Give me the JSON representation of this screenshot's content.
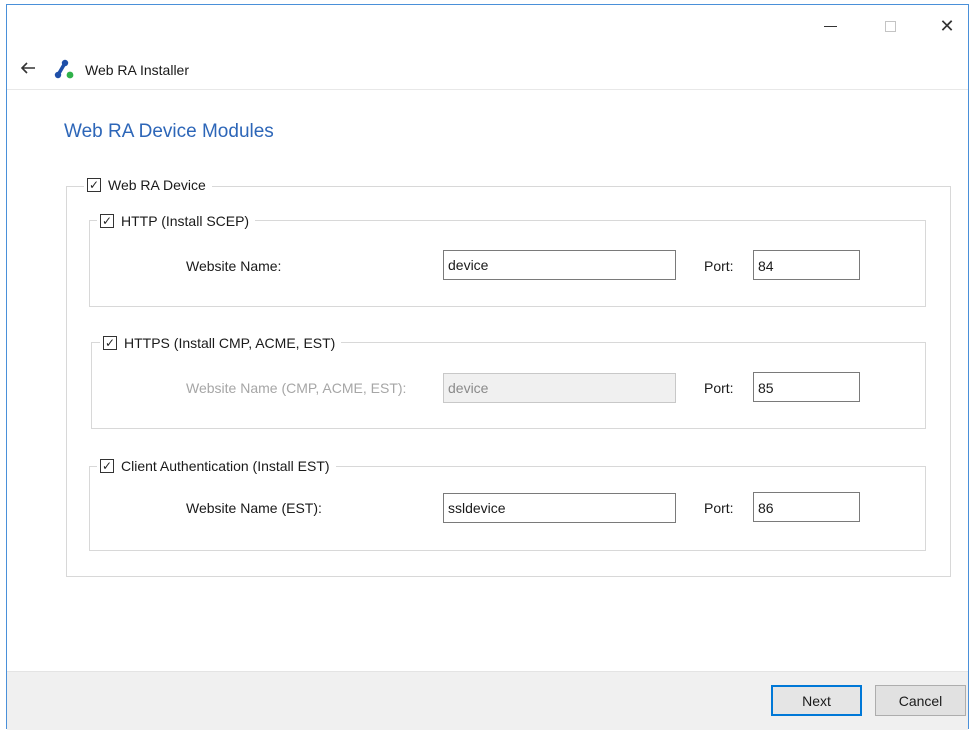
{
  "window": {
    "app_title": "Web RA Installer",
    "caption": {
      "minimize": "—",
      "maximize": "☐",
      "close": "✕"
    },
    "back_icon": "back-arrow-icon",
    "logo_icon": "app-logo-icon"
  },
  "page": {
    "title": "Web RA Device Modules"
  },
  "device_group": {
    "label": "Web RA Device",
    "checked": true
  },
  "http": {
    "label": "HTTP (Install SCEP)",
    "checked": true,
    "website_label": "Website Name:",
    "website_value": "device",
    "port_label": "Port:",
    "port_value": "84"
  },
  "https": {
    "label": "HTTPS (Install CMP, ACME, EST)",
    "checked": true,
    "website_label": "Website Name (CMP, ACME, EST):",
    "website_value": "device",
    "website_disabled": true,
    "port_label": "Port:",
    "port_value": "85"
  },
  "client_auth": {
    "label": "Client Authentication (Install EST)",
    "checked": true,
    "website_label": "Website Name (EST):",
    "website_value": "ssldevice",
    "port_label": "Port:",
    "port_value": "86"
  },
  "footer": {
    "next_label": "Next",
    "cancel_label": "Cancel"
  },
  "colors": {
    "accent": "#0078d7",
    "title_blue": "#2d66b8",
    "window_border": "#4a90d9"
  }
}
